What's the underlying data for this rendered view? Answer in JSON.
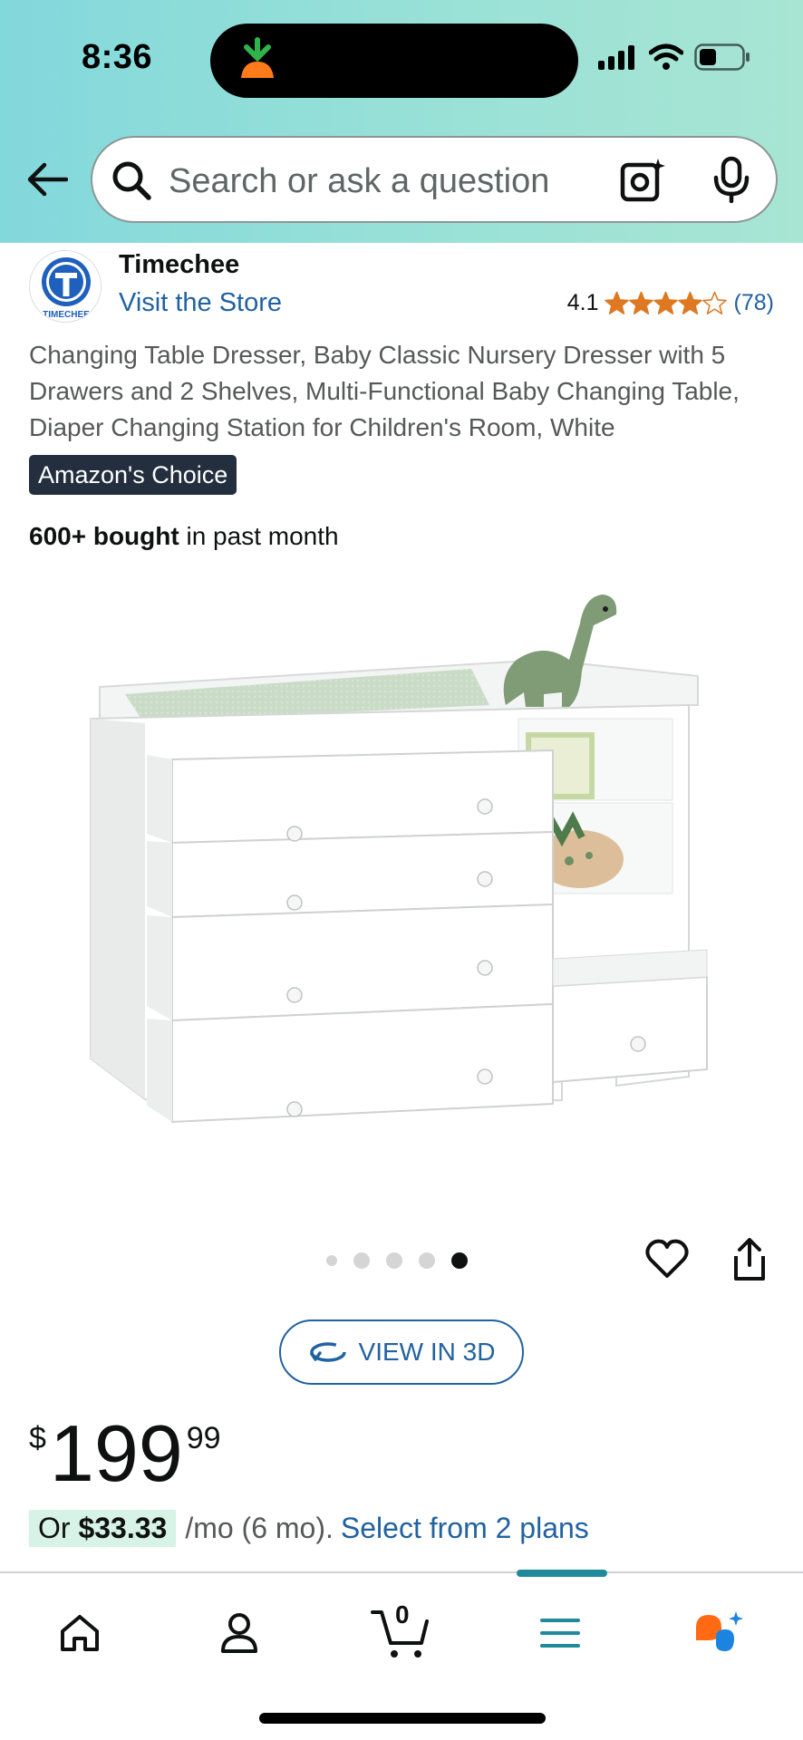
{
  "status_bar": {
    "time": "8:36"
  },
  "search": {
    "placeholder": "Search or ask a question"
  },
  "brand": {
    "name": "Timechee",
    "visit_store": "Visit the Store",
    "logo_letter": "T",
    "logo_text": "TIMECHEE"
  },
  "rating": {
    "value": "4.1",
    "stars": 4.1,
    "count": "(78)"
  },
  "product": {
    "title": "Changing Table Dresser, Baby Classic Nursery Dresser with 5 Drawers and 2 Shelves, Multi-Functional Baby Changing Table, Diaper Changing Station for Children's Room, White",
    "badge": "Amazon's Choice",
    "bought_bold": "600+ bought",
    "bought_rest": " in past month",
    "image_name": "white-changing-table-dresser"
  },
  "carousel": {
    "total": 5,
    "active": 5
  },
  "view3d": {
    "label": "VIEW IN 3D"
  },
  "price": {
    "symbol": "$",
    "whole": "199",
    "fraction": "99"
  },
  "installments": {
    "prefix": "Or ",
    "amount": "$33.33",
    "term": "/mo (6 mo).",
    "link": "Select from 2 plans"
  },
  "bottom_nav": {
    "cart_count": "0",
    "items": [
      "home-icon",
      "account-icon",
      "cart-icon",
      "menu-icon",
      "rufus-icon"
    ]
  },
  "colors": {
    "link": "#2162a1",
    "star": "#de7921",
    "badge_bg": "#232f3e",
    "nav_accent": "#1f8a99",
    "header_from": "#83d8dc",
    "header_to": "#a8e5d3"
  }
}
